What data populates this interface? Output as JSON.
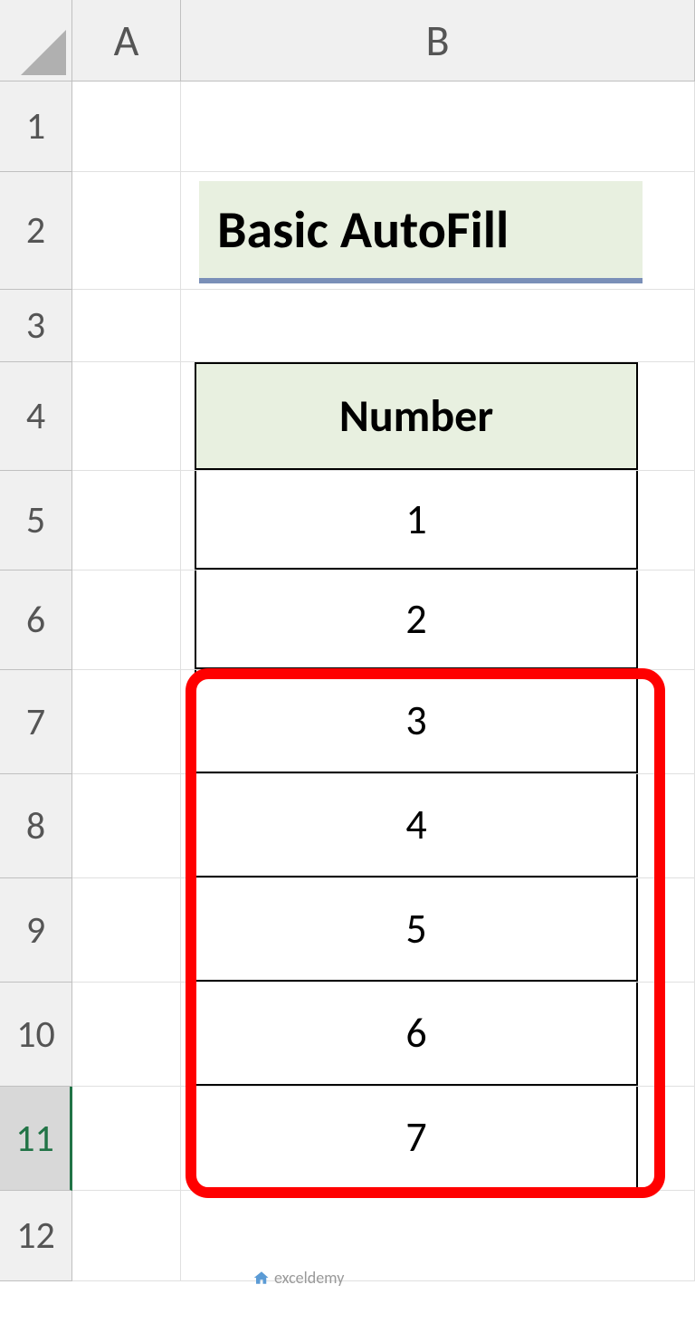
{
  "columns": [
    "A",
    "B"
  ],
  "rows": [
    "1",
    "2",
    "3",
    "4",
    "5",
    "6",
    "7",
    "8",
    "9",
    "10",
    "11",
    "12"
  ],
  "selectedRow": 11,
  "title": "Basic AutoFill",
  "tableHeader": "Number",
  "tableData": [
    "1",
    "2",
    "3",
    "4",
    "5",
    "6",
    "7"
  ],
  "highlightedRows": [
    3,
    4,
    5,
    6,
    7
  ],
  "watermark": "exceldemy",
  "chart_data": {
    "type": "table",
    "title": "Basic AutoFill",
    "columns": [
      "Number"
    ],
    "values": [
      1,
      2,
      3,
      4,
      5,
      6,
      7
    ]
  }
}
